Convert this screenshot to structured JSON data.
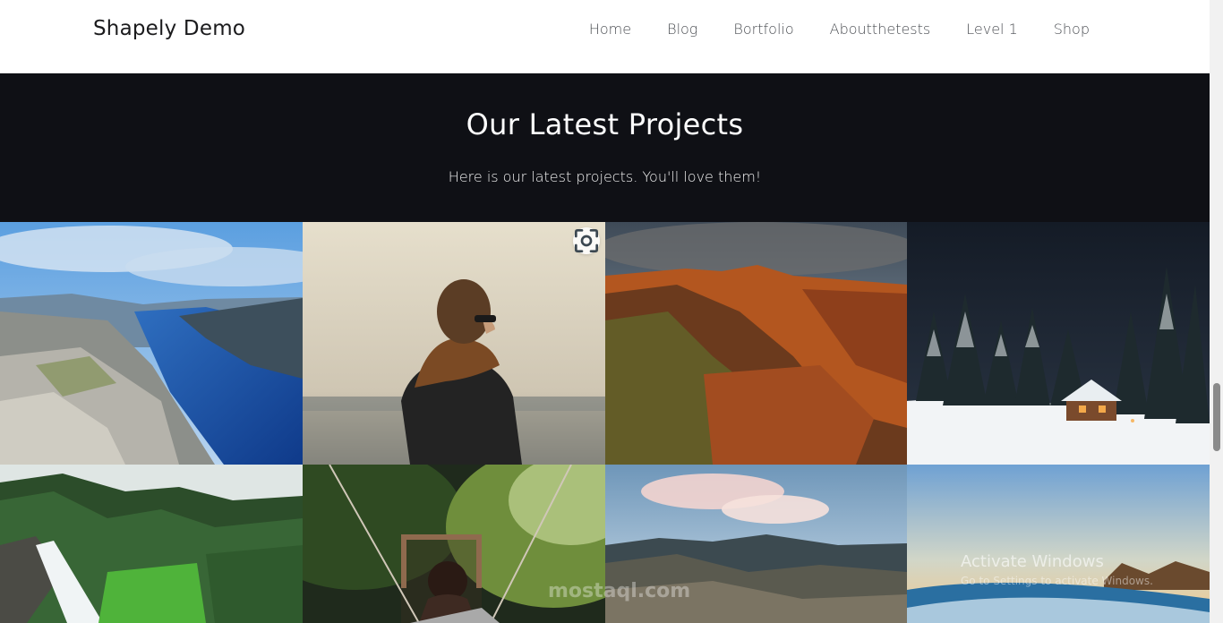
{
  "header": {
    "brand": "Shapely Demo",
    "nav": [
      "Home",
      "Blog",
      "Bortfolio",
      "Aboutthetests",
      "Level 1",
      "Shop"
    ]
  },
  "hero": {
    "title": "Our Latest Projects",
    "subtitle": "Here is our latest projects. You'll love them!"
  },
  "gallery": {
    "tiles": [
      {
        "subject": "fjord cliff overlook"
      },
      {
        "subject": "woman with scarf looking at sea"
      },
      {
        "subject": "red rock canyon at sunset"
      },
      {
        "subject": "snowy forest cabin at night"
      },
      {
        "subject": "waterfall in green forest"
      },
      {
        "subject": "woman on rope bridge"
      },
      {
        "subject": "mountain valley with clouds"
      },
      {
        "subject": "ocean wave at sunset"
      }
    ]
  },
  "watermark": {
    "activate_title": "Activate Windows",
    "activate_sub": "Go to Settings to activate Windows.",
    "site_mark": "mostaql.com"
  },
  "colors": {
    "hero_bg": "#0f1015",
    "text_dark": "#1b1b1d",
    "nav_text": "#4a4d52"
  },
  "icons": [
    "lens-search-icon"
  ]
}
